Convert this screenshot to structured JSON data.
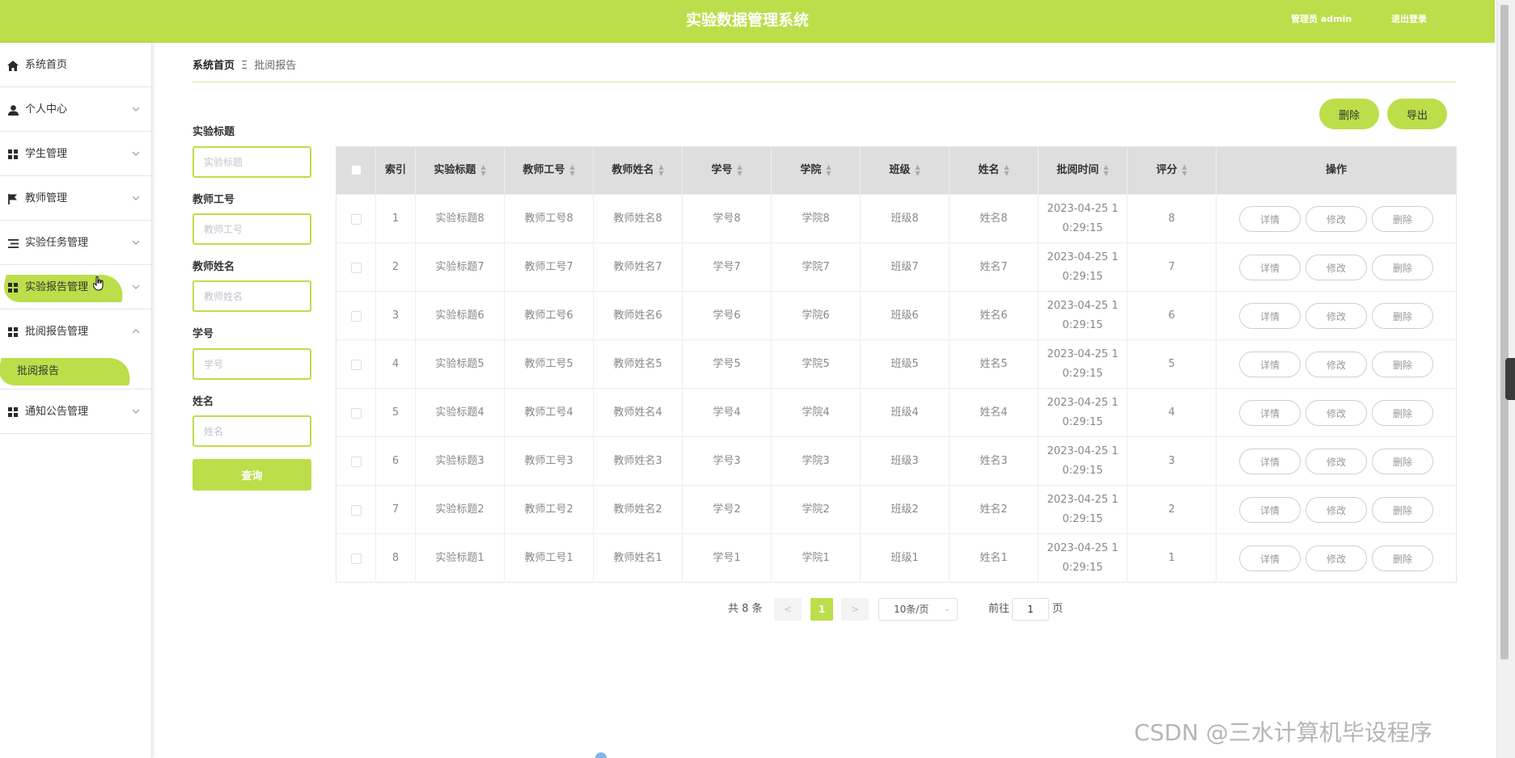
{
  "header": {
    "title": "实验数据管理系统",
    "admin": "管理员 admin",
    "logout": "退出登录"
  },
  "sidebar": {
    "items": [
      {
        "label": "系统首页",
        "icon": "home-icon"
      },
      {
        "label": "个人中心",
        "icon": "user-icon"
      },
      {
        "label": "学生管理",
        "icon": "grid-icon"
      },
      {
        "label": "教师管理",
        "icon": "flag-icon"
      },
      {
        "label": "实验任务管理",
        "icon": "list-icon"
      },
      {
        "label": "实验报告管理",
        "icon": "grid-icon"
      },
      {
        "label": "批阅报告管理",
        "icon": "grid-icon"
      },
      {
        "label": "通知公告管理",
        "icon": "grid-icon"
      }
    ],
    "sub_item": "批阅报告"
  },
  "breadcrumb": {
    "home": "系统首页",
    "separator": "Ξ",
    "current": "批阅报告"
  },
  "filters": {
    "title_label": "实验标题",
    "title_placeholder": "实验标题",
    "teacher_id_label": "教师工号",
    "teacher_id_placeholder": "教师工号",
    "teacher_name_label": "教师姓名",
    "teacher_name_placeholder": "教师姓名",
    "student_id_label": "学号",
    "student_id_placeholder": "学号",
    "name_label": "姓名",
    "name_placeholder": "姓名",
    "query_button": "查询"
  },
  "actions": {
    "delete": "删除",
    "export": "导出"
  },
  "table": {
    "columns": [
      "索引",
      "实验标题",
      "教师工号",
      "教师姓名",
      "学号",
      "学院",
      "班级",
      "姓名",
      "批阅时间",
      "评分",
      "操作"
    ],
    "rows": [
      {
        "index": "1",
        "title": "实验标题8",
        "teacher_id": "教师工号8",
        "teacher_name": "教师姓名8",
        "student_id": "学号8",
        "college": "学院8",
        "class": "班级8",
        "name": "姓名8",
        "time_a": "2023-04-25 1",
        "time_b": "0:29:15",
        "score": "8"
      },
      {
        "index": "2",
        "title": "实验标题7",
        "teacher_id": "教师工号7",
        "teacher_name": "教师姓名7",
        "student_id": "学号7",
        "college": "学院7",
        "class": "班级7",
        "name": "姓名7",
        "time_a": "2023-04-25 1",
        "time_b": "0:29:15",
        "score": "7"
      },
      {
        "index": "3",
        "title": "实验标题6",
        "teacher_id": "教师工号6",
        "teacher_name": "教师姓名6",
        "student_id": "学号6",
        "college": "学院6",
        "class": "班级6",
        "name": "姓名6",
        "time_a": "2023-04-25 1",
        "time_b": "0:29:15",
        "score": "6"
      },
      {
        "index": "4",
        "title": "实验标题5",
        "teacher_id": "教师工号5",
        "teacher_name": "教师姓名5",
        "student_id": "学号5",
        "college": "学院5",
        "class": "班级5",
        "name": "姓名5",
        "time_a": "2023-04-25 1",
        "time_b": "0:29:15",
        "score": "5"
      },
      {
        "index": "5",
        "title": "实验标题4",
        "teacher_id": "教师工号4",
        "teacher_name": "教师姓名4",
        "student_id": "学号4",
        "college": "学院4",
        "class": "班级4",
        "name": "姓名4",
        "time_a": "2023-04-25 1",
        "time_b": "0:29:15",
        "score": "4"
      },
      {
        "index": "6",
        "title": "实验标题3",
        "teacher_id": "教师工号3",
        "teacher_name": "教师姓名3",
        "student_id": "学号3",
        "college": "学院3",
        "class": "班级3",
        "name": "姓名3",
        "time_a": "2023-04-25 1",
        "time_b": "0:29:15",
        "score": "3"
      },
      {
        "index": "7",
        "title": "实验标题2",
        "teacher_id": "教师工号2",
        "teacher_name": "教师姓名2",
        "student_id": "学号2",
        "college": "学院2",
        "class": "班级2",
        "name": "姓名2",
        "time_a": "2023-04-25 1",
        "time_b": "0:29:15",
        "score": "2"
      },
      {
        "index": "8",
        "title": "实验标题1",
        "teacher_id": "教师工号1",
        "teacher_name": "教师姓名1",
        "student_id": "学号1",
        "college": "学院1",
        "class": "班级1",
        "name": "姓名1",
        "time_a": "2023-04-25 1",
        "time_b": "0:29:15",
        "score": "1"
      }
    ],
    "row_buttons": {
      "detail": "详情",
      "edit": "修改",
      "delete": "删除"
    }
  },
  "pagination": {
    "total": "共 8 条",
    "prev": "<",
    "current": "1",
    "next": ">",
    "page_size": "10条/页",
    "goto_label": "前往",
    "goto_value": "1",
    "page_suffix": "页"
  },
  "watermark": "CSDN @三水计算机毕设程序",
  "colors": {
    "accent": "#bcde4a",
    "header_text": "#ffffff",
    "table_header_bg": "#dedede"
  }
}
